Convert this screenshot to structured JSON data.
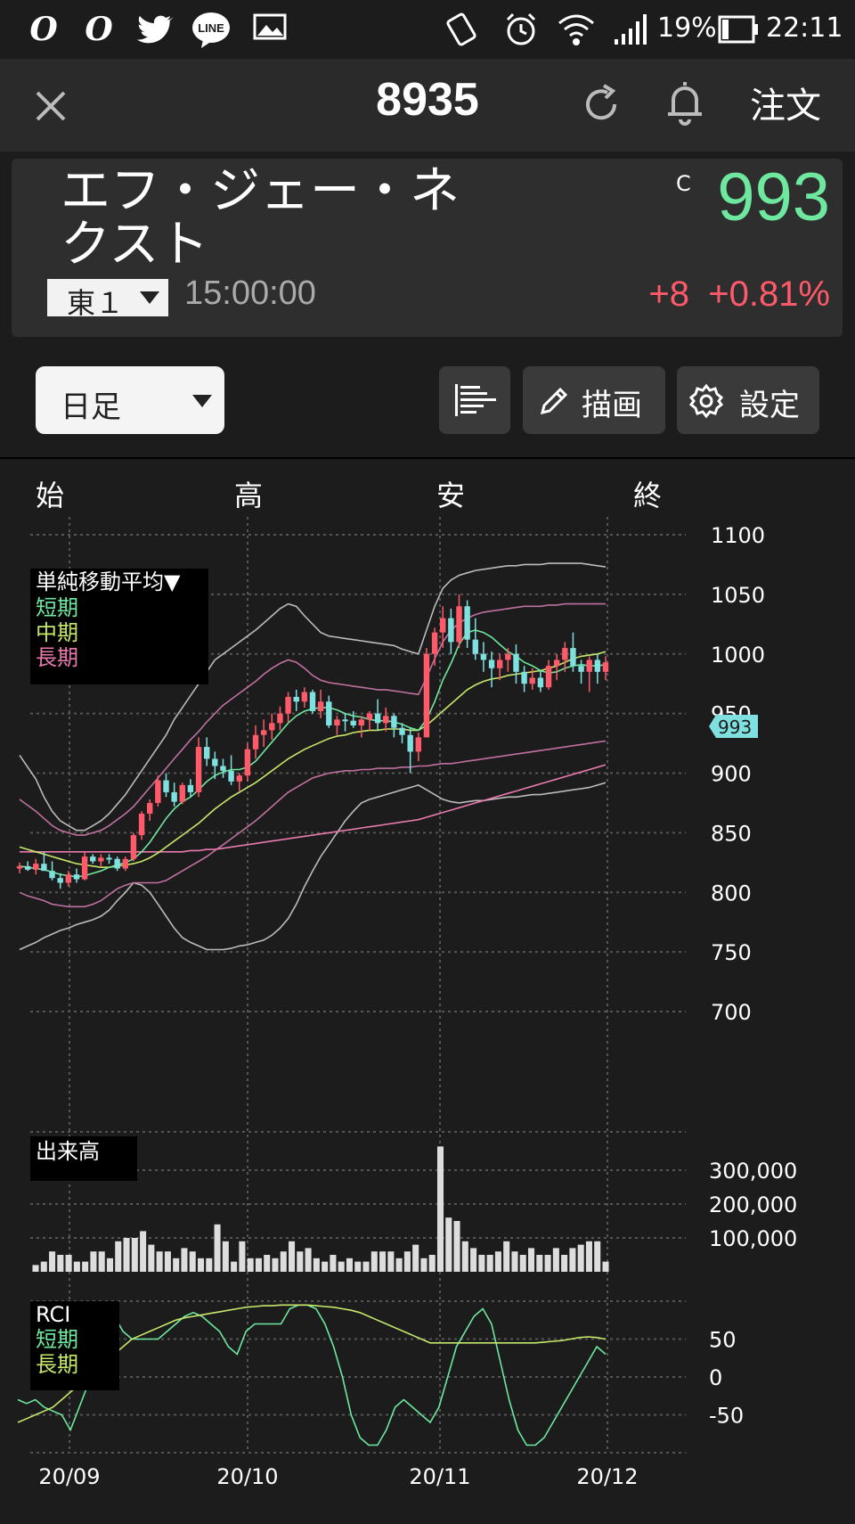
{
  "status": {
    "battery": "19%",
    "time": "22:11",
    "app_icons": [
      "opera-icon",
      "opera-icon",
      "twitter-icon",
      "line-icon",
      "image-icon"
    ],
    "line_label": "LINE"
  },
  "header": {
    "code": "8935",
    "order_label": "注文"
  },
  "stock": {
    "name_line1": "エフ・ジェー・ネ",
    "name_line2": "クスト",
    "market": "東１",
    "time": "15:00:00",
    "price_flag": "C",
    "price": "993",
    "change": "+8",
    "change_pct": "+0.81%",
    "colors": {
      "up": "#6ee89e",
      "down": "#ff5a6a"
    }
  },
  "toolbar": {
    "period": "日足",
    "draw_label": "描画",
    "settings_label": "設定"
  },
  "ohlc_header": {
    "open": "始",
    "high": "高",
    "low": "安",
    "close": "終"
  },
  "chart_data": [
    {
      "type": "candlestick",
      "legend_title": "単純移動平均▼",
      "legend": [
        "短期",
        "中期",
        "長期"
      ],
      "ylim": [
        700,
        1100
      ],
      "y_ticks": [
        "1100",
        "1050",
        "1000",
        "950",
        "900",
        "850",
        "800",
        "750",
        "700"
      ],
      "price_tag": "993",
      "candles": [
        [
          820,
          825,
          816,
          822
        ],
        [
          822,
          826,
          818,
          819
        ],
        [
          819,
          828,
          815,
          824
        ],
        [
          824,
          834,
          818,
          818
        ],
        [
          818,
          826,
          810,
          812
        ],
        [
          812,
          816,
          803,
          808
        ],
        [
          808,
          818,
          805,
          815
        ],
        [
          815,
          820,
          808,
          811
        ],
        [
          811,
          834,
          810,
          830
        ],
        [
          830,
          832,
          824,
          826
        ],
        [
          826,
          832,
          822,
          829
        ],
        [
          829,
          832,
          824,
          828
        ],
        [
          828,
          830,
          818,
          820
        ],
        [
          820,
          830,
          818,
          828
        ],
        [
          828,
          850,
          826,
          848
        ],
        [
          848,
          868,
          844,
          866
        ],
        [
          866,
          878,
          860,
          875
        ],
        [
          875,
          898,
          872,
          894
        ],
        [
          894,
          900,
          880,
          884
        ],
        [
          884,
          892,
          872,
          876
        ],
        [
          876,
          892,
          874,
          890
        ],
        [
          890,
          895,
          880,
          884
        ],
        [
          884,
          930,
          880,
          922
        ],
        [
          922,
          930,
          906,
          912
        ],
        [
          912,
          918,
          895,
          906
        ],
        [
          906,
          912,
          896,
          902
        ],
        [
          902,
          915,
          890,
          893
        ],
        [
          893,
          900,
          885,
          898
        ],
        [
          898,
          925,
          893,
          920
        ],
        [
          920,
          940,
          912,
          932
        ],
        [
          932,
          945,
          922,
          936
        ],
        [
          936,
          950,
          928,
          942
        ],
        [
          942,
          956,
          936,
          950
        ],
        [
          950,
          968,
          942,
          964
        ],
        [
          964,
          970,
          952,
          960
        ],
        [
          960,
          972,
          955,
          968
        ],
        [
          968,
          970,
          950,
          952
        ],
        [
          952,
          970,
          946,
          960
        ],
        [
          960,
          965,
          938,
          940
        ],
        [
          940,
          948,
          932,
          945
        ],
        [
          945,
          950,
          935,
          944
        ],
        [
          944,
          952,
          938,
          940
        ],
        [
          940,
          948,
          930,
          945
        ],
        [
          945,
          952,
          936,
          950
        ],
        [
          950,
          962,
          936,
          942
        ],
        [
          942,
          955,
          935,
          948
        ],
        [
          948,
          950,
          930,
          938
        ],
        [
          938,
          942,
          925,
          932
        ],
        [
          932,
          938,
          900,
          918
        ],
        [
          918,
          934,
          910,
          930
        ],
        [
          930,
          1005,
          930,
          1000
        ],
        [
          1000,
          1022,
          990,
          1018
        ],
        [
          1018,
          1040,
          1005,
          1030
        ],
        [
          1030,
          1038,
          1000,
          1010
        ],
        [
          1010,
          1050,
          1005,
          1040
        ],
        [
          1040,
          1045,
          1005,
          1012
        ],
        [
          1012,
          1030,
          995,
          1000
        ],
        [
          1000,
          1010,
          985,
          995
        ],
        [
          995,
          1002,
          972,
          988
        ],
        [
          988,
          1000,
          978,
          995
        ],
        [
          995,
          1005,
          985,
          1000
        ],
        [
          1000,
          1008,
          975,
          985
        ],
        [
          985,
          990,
          968,
          975
        ],
        [
          975,
          988,
          970,
          980
        ],
        [
          980,
          986,
          968,
          972
        ],
        [
          972,
          995,
          970,
          990
        ],
        [
          990,
          1000,
          978,
          995
        ],
        [
          995,
          1010,
          985,
          1005
        ],
        [
          1005,
          1018,
          985,
          990
        ],
        [
          990,
          995,
          975,
          985
        ],
        [
          985,
          998,
          968,
          995
        ],
        [
          995,
          1000,
          975,
          985
        ],
        [
          985,
          998,
          978,
          993
        ]
      ],
      "ma_short": [
        822,
        821,
        820,
        819,
        817,
        815,
        814,
        813,
        814,
        816,
        818,
        821,
        823,
        825,
        828,
        834,
        842,
        852,
        862,
        870,
        876,
        880,
        886,
        893,
        898,
        901,
        903,
        903,
        905,
        910,
        918,
        926,
        934,
        942,
        948,
        952,
        954,
        955,
        955,
        953,
        950,
        948,
        947,
        945,
        944,
        944,
        943,
        941,
        938,
        936,
        945,
        960,
        978,
        992,
        1008,
        1018,
        1020,
        1018,
        1014,
        1008,
        1002,
        998,
        993,
        990,
        986,
        984,
        985,
        988,
        990,
        991,
        990,
        990,
        991
      ],
      "ma_mid": [
        838,
        836,
        834,
        832,
        830,
        828,
        826,
        824,
        823,
        822,
        821,
        821,
        822,
        823,
        824,
        826,
        829,
        833,
        838,
        843,
        848,
        853,
        858,
        864,
        870,
        875,
        880,
        884,
        888,
        892,
        897,
        902,
        907,
        912,
        916,
        920,
        923,
        926,
        929,
        931,
        932,
        934,
        935,
        936,
        936,
        937,
        937,
        937,
        936,
        936,
        940,
        946,
        952,
        958,
        964,
        970,
        974,
        977,
        979,
        980,
        982,
        983,
        984,
        985,
        986,
        988,
        990,
        993,
        996,
        998,
        999,
        1000,
        1002
      ],
      "ma_long": [
        834,
        834,
        834,
        834,
        834,
        834,
        834,
        834,
        834,
        834,
        834,
        834,
        834,
        834,
        834,
        834,
        834,
        834,
        834,
        834,
        834,
        835,
        835,
        836,
        836,
        837,
        838,
        839,
        840,
        841,
        842,
        843,
        844,
        845,
        846,
        847,
        848,
        849,
        850,
        851,
        852,
        853,
        854,
        855,
        856,
        857,
        858,
        859,
        860,
        861,
        863,
        865,
        867,
        869,
        871,
        873,
        875,
        877,
        879,
        881,
        883,
        885,
        887,
        889,
        891,
        893,
        895,
        897,
        899,
        901,
        903,
        905,
        907
      ],
      "bb_upper_outer": [
        915,
        905,
        895,
        880,
        868,
        860,
        856,
        852,
        852,
        856,
        860,
        866,
        874,
        882,
        892,
        902,
        912,
        922,
        932,
        945,
        955,
        965,
        975,
        985,
        995,
        1000,
        1005,
        1010,
        1015,
        1020,
        1026,
        1032,
        1038,
        1042,
        1040,
        1032,
        1025,
        1018,
        1015,
        1014,
        1013,
        1012,
        1011,
        1010,
        1009,
        1008,
        1007,
        1004,
        1002,
        1000,
        1020,
        1040,
        1055,
        1062,
        1066,
        1068,
        1070,
        1071,
        1072,
        1073,
        1074,
        1074,
        1075,
        1075,
        1075,
        1076,
        1076,
        1076,
        1076,
        1076,
        1075,
        1074,
        1073
      ],
      "bb_upper_inner": [
        878,
        873,
        868,
        862,
        856,
        852,
        850,
        848,
        848,
        850,
        852,
        856,
        861,
        866,
        872,
        880,
        888,
        896,
        904,
        912,
        920,
        928,
        935,
        943,
        950,
        957,
        962,
        967,
        972,
        977,
        983,
        988,
        992,
        995,
        993,
        988,
        982,
        978,
        976,
        975,
        974,
        973,
        972,
        971,
        970,
        970,
        969,
        968,
        967,
        966,
        980,
        996,
        1010,
        1020,
        1026,
        1030,
        1033,
        1035,
        1036,
        1037,
        1038,
        1039,
        1040,
        1040,
        1040,
        1041,
        1041,
        1042,
        1042,
        1042,
        1042,
        1042,
        1042
      ],
      "bb_lower_inner": [
        800,
        797,
        795,
        793,
        790,
        789,
        788,
        788,
        788,
        790,
        793,
        798,
        803,
        806,
        808,
        808,
        808,
        808,
        810,
        814,
        818,
        822,
        826,
        830,
        835,
        840,
        845,
        850,
        855,
        860,
        866,
        872,
        878,
        884,
        888,
        892,
        896,
        898,
        900,
        901,
        902,
        902,
        903,
        903,
        904,
        904,
        904,
        905,
        905,
        906,
        906,
        907,
        908,
        908,
        909,
        910,
        911,
        912,
        913,
        914,
        915,
        916,
        917,
        918,
        919,
        920,
        921,
        922,
        923,
        924,
        925,
        926,
        927
      ],
      "bb_lower_outer": [
        752,
        755,
        758,
        762,
        765,
        768,
        770,
        773,
        775,
        777,
        780,
        785,
        793,
        800,
        808,
        806,
        800,
        790,
        780,
        770,
        762,
        758,
        755,
        752,
        752,
        752,
        753,
        755,
        756,
        758,
        760,
        764,
        770,
        778,
        790,
        805,
        818,
        830,
        840,
        850,
        860,
        868,
        875,
        878,
        880,
        882,
        884,
        886,
        888,
        890,
        886,
        882,
        878,
        876,
        875,
        876,
        877,
        877,
        878,
        879,
        880,
        880,
        881,
        882,
        882,
        883,
        884,
        885,
        886,
        887,
        888,
        890,
        892
      ],
      "x_ticks": [
        "20/09",
        "20/10",
        "20/11",
        "20/12"
      ]
    },
    {
      "type": "bar",
      "title": "出来高",
      "y_ticks": [
        "300,000",
        "200,000",
        "100,000"
      ],
      "ylim": [
        0,
        400000
      ],
      "values": [
        20000,
        30000,
        60000,
        50000,
        50000,
        30000,
        30000,
        60000,
        60000,
        40000,
        90000,
        100000,
        100000,
        120000,
        80000,
        60000,
        60000,
        40000,
        70000,
        60000,
        40000,
        40000,
        140000,
        90000,
        30000,
        90000,
        40000,
        40000,
        50000,
        40000,
        60000,
        90000,
        60000,
        70000,
        40000,
        30000,
        50000,
        30000,
        40000,
        30000,
        30000,
        60000,
        60000,
        60000,
        40000,
        60000,
        80000,
        40000,
        50000,
        370000,
        160000,
        150000,
        90000,
        70000,
        50000,
        50000,
        60000,
        90000,
        60000,
        50000,
        70000,
        50000,
        50000,
        70000,
        50000,
        70000,
        80000,
        90000,
        90000,
        30000
      ],
      "x_ticks": [
        "20/09",
        "20/10",
        "20/11",
        "20/12"
      ]
    },
    {
      "type": "line",
      "title": "RCI",
      "legend": [
        "短期",
        "長期"
      ],
      "ylim": [
        -100,
        100
      ],
      "y_ticks": [
        "50",
        "0",
        "-50"
      ],
      "series": [
        {
          "name": "短期",
          "values": [
            -30,
            -35,
            -30,
            -40,
            -45,
            -50,
            -70,
            -40,
            -10,
            20,
            60,
            80,
            60,
            50,
            50,
            50,
            50,
            60,
            70,
            80,
            85,
            80,
            70,
            60,
            40,
            30,
            60,
            70,
            70,
            70,
            70,
            90,
            95,
            95,
            90,
            70,
            40,
            0,
            -50,
            -80,
            -90,
            -90,
            -70,
            -40,
            -30,
            -40,
            -50,
            -60,
            -40,
            0,
            40,
            60,
            80,
            90,
            70,
            20,
            -30,
            -70,
            -90,
            -90,
            -80,
            -60,
            -40,
            -20,
            0,
            20,
            40,
            30
          ]
        },
        {
          "name": "長期",
          "values": [
            -60,
            -55,
            -50,
            -45,
            -40,
            -30,
            -20,
            -10,
            0,
            10,
            20,
            30,
            40,
            50,
            55,
            60,
            65,
            70,
            75,
            78,
            80,
            82,
            84,
            86,
            88,
            90,
            92,
            93,
            94,
            94,
            95,
            95,
            95,
            95,
            94,
            93,
            92,
            90,
            88,
            85,
            80,
            75,
            70,
            65,
            60,
            55,
            50,
            45,
            45,
            45,
            45,
            45,
            45,
            45,
            45,
            45,
            45,
            45,
            45,
            45,
            46,
            47,
            48,
            50,
            52,
            53,
            52,
            50
          ]
        }
      ],
      "x_ticks": [
        "20/09",
        "20/10",
        "20/11",
        "20/12"
      ]
    }
  ]
}
